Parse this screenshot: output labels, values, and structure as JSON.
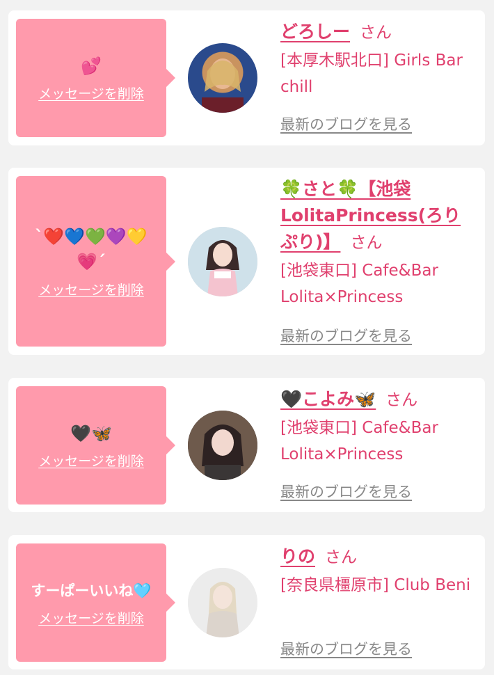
{
  "items": [
    {
      "message": "💕",
      "delete_label": "メッセージを削除",
      "name": "どろしー",
      "san": "さん",
      "shop": "[本厚木駅北口] Girls Bar chill",
      "blog_label": "最新のブログを見る"
    },
    {
      "message": "`❤️💙💚💜💛💗´",
      "delete_label": "メッセージを削除",
      "name": "🍀さと🍀【池袋LolitaPrincess(ろりぷり)】",
      "san": "さん",
      "shop": "[池袋東口] Cafe&Bar Lolita×Princess",
      "blog_label": "最新のブログを見る"
    },
    {
      "message": "🖤🦋",
      "delete_label": "メッセージを削除",
      "name": "🖤こよみ🦋",
      "san": "さん",
      "shop": "[池袋東口] Cafe&Bar Lolita×Princess",
      "blog_label": "最新のブログを見る"
    },
    {
      "message": "すーぱーいいね🩵",
      "delete_label": "メッセージを削除",
      "name": "りの",
      "san": "さん",
      "shop": "[奈良県橿原市] Club Beni",
      "blog_label": "最新のブログを見る"
    }
  ]
}
